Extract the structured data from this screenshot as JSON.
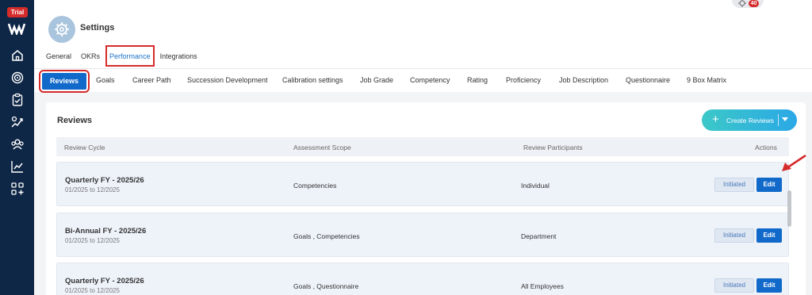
{
  "sidebar": {
    "badge": "Trial",
    "icons": [
      "logo-icon",
      "home-icon",
      "target-icon",
      "clipboard-check-icon",
      "chart-pen-icon",
      "users-icon",
      "trend-icon",
      "apps-add-icon"
    ]
  },
  "header": {
    "title": "Settings",
    "notification_count": "40",
    "tabs": [
      "General",
      "OKRs",
      "Performance",
      "Integrations"
    ],
    "active_tab": "Performance"
  },
  "subtabs": [
    "Reviews",
    "Goals",
    "Career Path",
    "Succession Development",
    "Calibration settings",
    "Job Grade",
    "Competency",
    "Rating",
    "Proficiency",
    "Job Description",
    "Questionnaire",
    "9 Box Matrix"
  ],
  "reviews": {
    "title": "Reviews",
    "create_label": "Create Reviews",
    "columns": [
      "Review Cycle",
      "Assessment Scope",
      "Review Participants",
      "Actions"
    ],
    "rows": [
      {
        "name": "Quarterly FY - 2025/26",
        "dates": "01/2025 to 12/2025",
        "scope": "Competencies",
        "participants": "Individual",
        "status": "Initiated",
        "action": "Edit"
      },
      {
        "name": "Bi-Annual FY - 2025/26",
        "dates": "01/2025 to 12/2025",
        "scope": "Goals , Competencies",
        "participants": "Department",
        "status": "Initiated",
        "action": "Edit"
      },
      {
        "name": "Quarterly FY - 2025/26",
        "dates": "01/2025 to 12/2025",
        "scope": "Goals , Questionnaire",
        "participants": "All Employees",
        "status": "Initiated",
        "action": "Edit"
      }
    ]
  },
  "colors": {
    "sidebar": "#0f2746",
    "primary": "#1169c9",
    "highlight": "#d52b2b",
    "accent_gradient": "#3cc8c8"
  }
}
